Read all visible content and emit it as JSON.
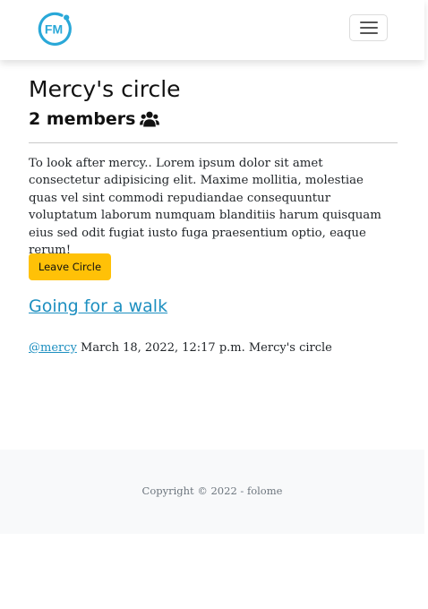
{
  "header": {
    "logo_text": "FM",
    "brand_color": "#29a8d8",
    "menu_icon": "hamburger-menu-icon"
  },
  "circle": {
    "title": "Mercy's circle",
    "members_label": "2 members",
    "members_icon": "users-icon",
    "description": "To look after mercy.. Lorem ipsum dolor sit amet consectetur adipisicing elit. Maxime mollitia, molestiae quas vel sint commodi repudiandae consequuntur voluptatum laborum numquam blanditiis harum quisquam eius sed odit fugiat iusto fuga praesentium optio, eaque rerum!",
    "leave_button": "Leave Circle",
    "leave_button_color": "#ffc107"
  },
  "post": {
    "title": "Going for a walk",
    "author": "@mercy",
    "meta": "March 18, 2022, 12:17 p.m. Mercy's circle",
    "link_color": "#1d8fc0"
  },
  "footer": {
    "copyright": "Copyright © 2022 - folome"
  }
}
